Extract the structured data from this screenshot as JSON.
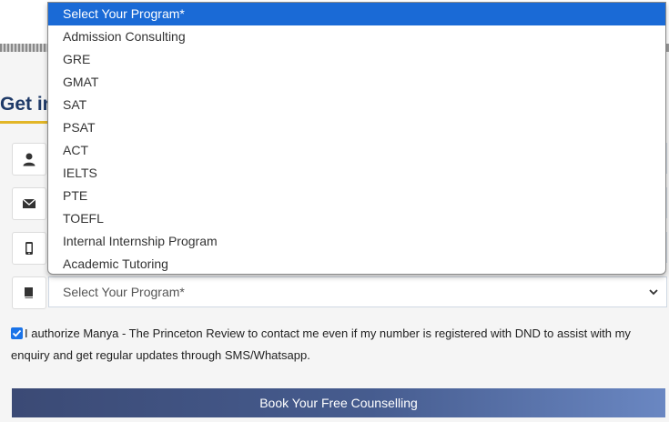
{
  "heading": "Get in",
  "form": {
    "program_select": {
      "selected_value": "Select Your Program*"
    }
  },
  "dropdown": {
    "options": [
      "Select Your Program*",
      "Admission Consulting",
      "GRE",
      "GMAT",
      "SAT",
      "PSAT",
      "ACT",
      "IELTS",
      "PTE",
      "TOEFL",
      "Internal Internship Program",
      "Academic Tutoring"
    ],
    "highlighted_index": 0
  },
  "consent": {
    "checked": true,
    "text": "I authorize Manya - The Princeton Review to contact me even if my number is registered with DND to assist with my enquiry and get regular updates through SMS/Whatsapp."
  },
  "cta": {
    "label": "Book Your Free Counselling"
  },
  "icons": {
    "name": "user-icon",
    "email": "envelope-icon",
    "phone": "mobile-phone-icon",
    "program": "book-icon"
  },
  "colors": {
    "highlight": "#1a6ad6",
    "heading": "#1f3a68",
    "accent": "#e2b627",
    "checkbox": "#1a73e8"
  }
}
